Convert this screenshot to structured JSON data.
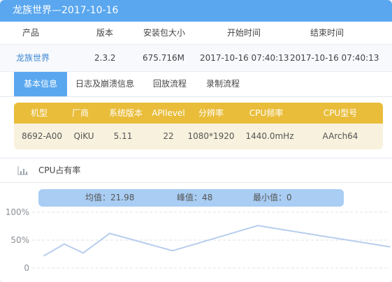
{
  "window": {
    "title": "龙族世界—2017-10-16"
  },
  "info": {
    "headers": [
      "产品",
      "版本",
      "安装包大小",
      "开始时间",
      "结束时间"
    ],
    "row": [
      "龙族世界",
      "2.3.2",
      "675.716M",
      "2017-10-16 07:40:13",
      "2017-10-16 07:40:13"
    ]
  },
  "tabs": [
    {
      "label": "基本信息",
      "active": true
    },
    {
      "label": "日志及崩溃信息",
      "active": false
    },
    {
      "label": "回放流程",
      "active": false
    },
    {
      "label": "录制流程",
      "active": false
    }
  ],
  "specs": {
    "headers": [
      "机型",
      "厂商",
      "系统版本",
      "APIlevel",
      "分辨率",
      "CPU频率",
      "CPU型号"
    ],
    "values": [
      "8692-A00",
      "QiKU",
      "5.11",
      "22",
      "1080*1920",
      "1440.0mHz",
      "AArch64"
    ]
  },
  "cpu_section": {
    "title": "CPU占有率",
    "icon": "bar-chart-icon"
  },
  "stats": {
    "avg": "均值：21.98",
    "peak": "峰值：48",
    "min": "最小值：0"
  },
  "colors": {
    "title_bar": "#5aa7ef",
    "active_tab": "#5aa7ef",
    "specs_header": "#e9bd3a",
    "specs_body": "#f8f1dd",
    "stats_bar": "#a9cdf3",
    "line": "#b7cdee",
    "link": "#3a86d6"
  },
  "chart_data": {
    "type": "line",
    "title": "",
    "xlabel": "",
    "ylabel": "",
    "yticks": [
      "100%",
      "50%",
      "0"
    ],
    "ylim": [
      0,
      100
    ],
    "grid": true,
    "series": [
      {
        "x": [
          0,
          1,
          2,
          3,
          4,
          5,
          6,
          7
        ],
        "values": [
          22,
          43,
          27,
          62,
          31,
          76,
          58,
          38
        ]
      }
    ]
  }
}
